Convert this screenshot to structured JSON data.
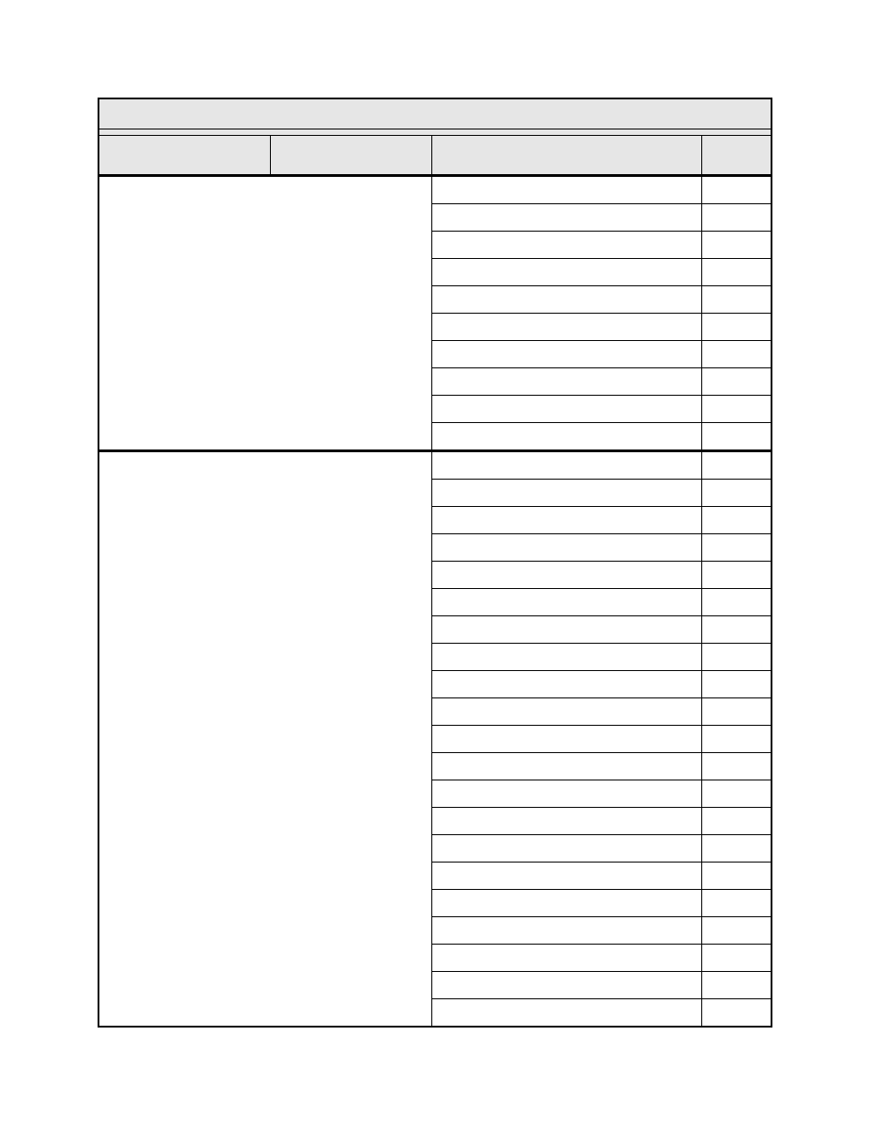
{
  "table": {
    "title": "",
    "headers": {
      "col1": "",
      "col2": "",
      "col3": "",
      "col4": ""
    },
    "groups": [
      {
        "left_col1": "",
        "left_col2": "",
        "rows": [
          {
            "c3": "",
            "c4": ""
          },
          {
            "c3": "",
            "c4": ""
          },
          {
            "c3": "",
            "c4": ""
          },
          {
            "c3": "",
            "c4": ""
          },
          {
            "c3": "",
            "c4": ""
          },
          {
            "c3": "",
            "c4": ""
          },
          {
            "c3": "",
            "c4": ""
          },
          {
            "c3": "",
            "c4": ""
          },
          {
            "c3": "",
            "c4": ""
          },
          {
            "c3": "",
            "c4": ""
          }
        ]
      },
      {
        "left_col1": "",
        "left_col2": "",
        "rows": [
          {
            "c3": "",
            "c4": ""
          },
          {
            "c3": "",
            "c4": ""
          },
          {
            "c3": "",
            "c4": ""
          },
          {
            "c3": "",
            "c4": ""
          },
          {
            "c3": "",
            "c4": ""
          },
          {
            "c3": "",
            "c4": ""
          },
          {
            "c3": "",
            "c4": ""
          },
          {
            "c3": "",
            "c4": ""
          },
          {
            "c3": "",
            "c4": ""
          },
          {
            "c3": "",
            "c4": ""
          },
          {
            "c3": "",
            "c4": ""
          },
          {
            "c3": "",
            "c4": ""
          },
          {
            "c3": "",
            "c4": ""
          },
          {
            "c3": "",
            "c4": ""
          },
          {
            "c3": "",
            "c4": ""
          },
          {
            "c3": "",
            "c4": ""
          },
          {
            "c3": "",
            "c4": ""
          },
          {
            "c3": "",
            "c4": ""
          },
          {
            "c3": "",
            "c4": ""
          },
          {
            "c3": "",
            "c4": ""
          },
          {
            "c3": "",
            "c4": ""
          }
        ]
      }
    ]
  }
}
